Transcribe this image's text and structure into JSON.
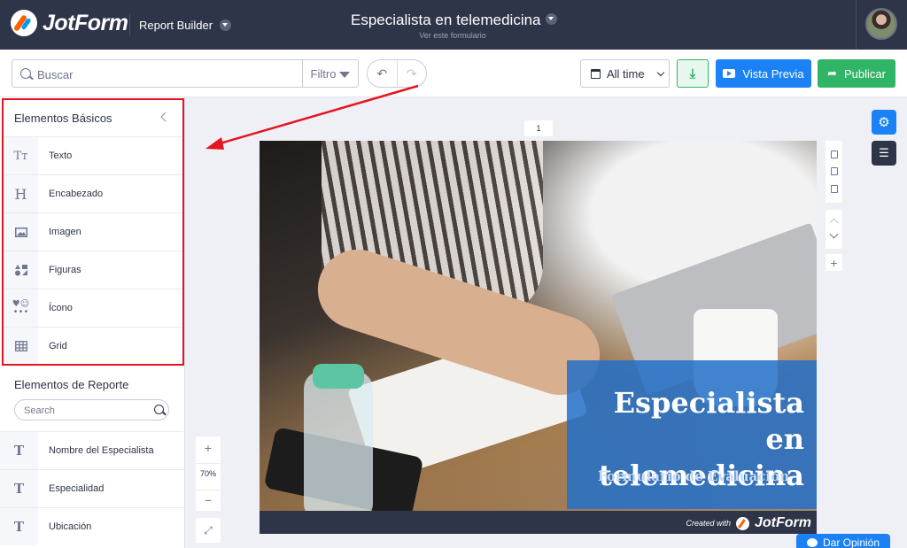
{
  "header": {
    "brand": "JotForm",
    "app_name": "Report Builder",
    "form_title": "Especialista en telemedicina",
    "form_link": "Ver este formulario"
  },
  "toolbar": {
    "search_placeholder": "Buscar",
    "filter_label": "Filtro",
    "undo_icon": "undo-icon",
    "redo_icon": "redo-icon",
    "date_range": "All time",
    "download_icon": "download-icon",
    "preview_label": "Vista Previa",
    "publish_label": "Publicar"
  },
  "left_panel": {
    "basic_title": "Elementos Básicos",
    "basic_items": [
      {
        "label": "Texto",
        "icon": "Tт"
      },
      {
        "label": "Encabezado",
        "icon": "H"
      },
      {
        "label": "Imagen",
        "icon": "image-icon"
      },
      {
        "label": "Figuras",
        "icon": "shapes-icon"
      },
      {
        "label": "Ícono",
        "icon": "icons-icon"
      },
      {
        "label": "Grid",
        "icon": "grid-icon"
      }
    ],
    "report_title": "Elementos de Reporte",
    "search_placeholder": "Search",
    "report_items": [
      {
        "label": "Nombre del Especialista",
        "icon": "T"
      },
      {
        "label": "Especialidad",
        "icon": "T"
      },
      {
        "label": "Ubicación",
        "icon": "T"
      }
    ]
  },
  "canvas": {
    "page_number": "1",
    "cover_title": "Especialista en telemedicina",
    "cover_subtitle": "Formulario de Evaluación",
    "created_with": "Created with",
    "created_brand": "JotForm",
    "zoom": "70%"
  },
  "feedback_label": "Dar Opinión",
  "colors": {
    "header_bg": "#2f3549",
    "accent_blue": "#1a82f5",
    "accent_green": "#30b566",
    "highlight_red": "#e5141f"
  }
}
